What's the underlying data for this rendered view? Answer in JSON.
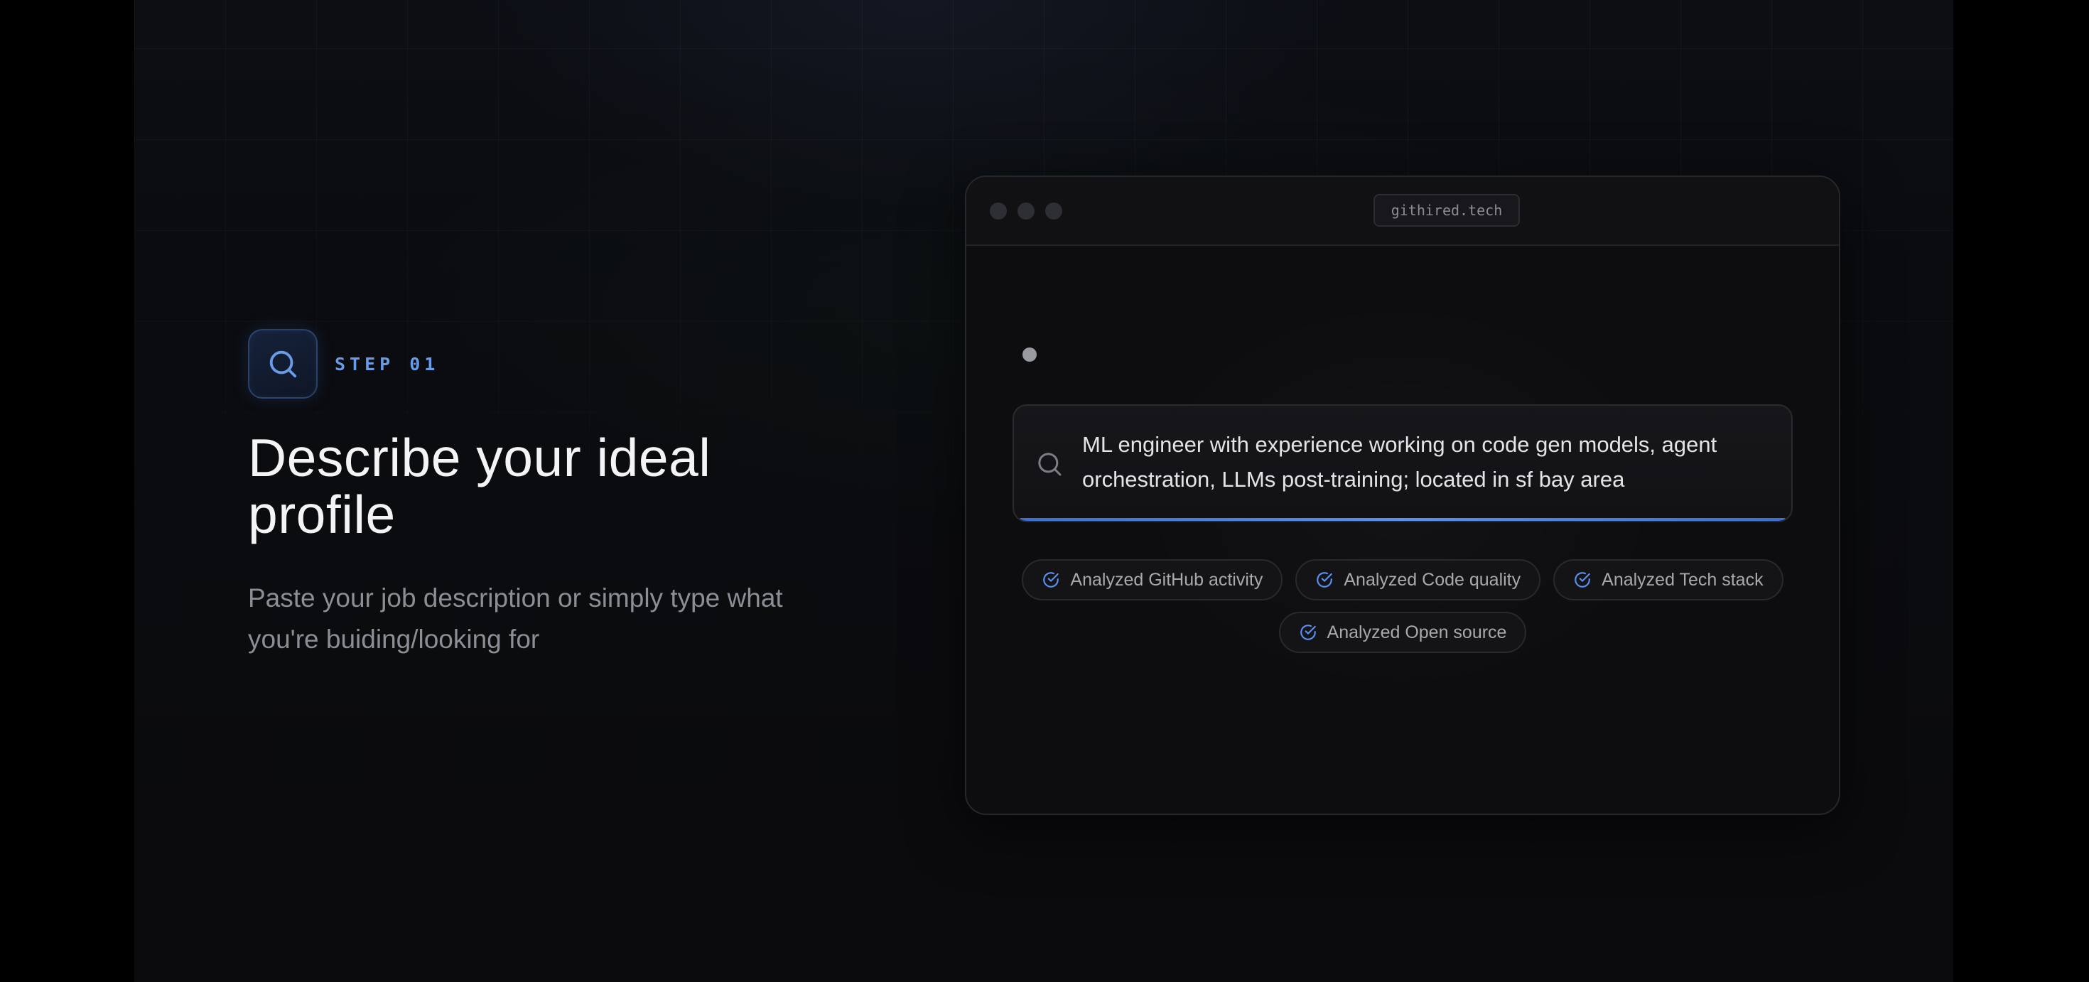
{
  "step": {
    "label": "STEP 01",
    "icon": "search-icon"
  },
  "headline": "Describe your ideal profile",
  "subtext": "Paste your job description or simply type what you're buiding/looking for",
  "browser": {
    "url": "githired.tech",
    "search": {
      "icon": "search-icon",
      "value": "ML engineer with experience working on code gen models, agent orchestration, LLMs post-training; located in sf bay area"
    },
    "chips": [
      {
        "label": "Analyzed GitHub activity",
        "icon": "check-circle-icon"
      },
      {
        "label": "Analyzed Code quality",
        "icon": "check-circle-icon"
      },
      {
        "label": "Analyzed Tech stack",
        "icon": "check-circle-icon"
      },
      {
        "label": "Analyzed Open source",
        "icon": "check-circle-icon"
      }
    ]
  },
  "colors": {
    "accent": "#5b8ff0",
    "step_label": "#6a9be6",
    "headline": "#f4f4f6",
    "subtext": "#8d8e95",
    "background": "#0b0b0d"
  }
}
